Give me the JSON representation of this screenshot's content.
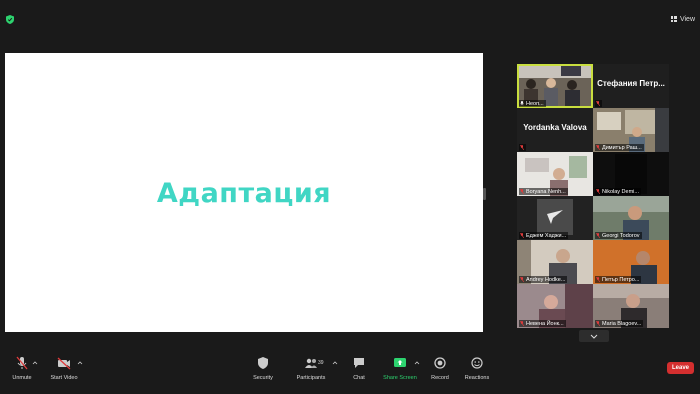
{
  "header": {
    "view_label": "View"
  },
  "share": {
    "slide_title": "Адаптация"
  },
  "participants": [
    {
      "name": "Неоп...",
      "video": true,
      "speaking": true
    },
    {
      "name": "Стефания Петр...",
      "video": false,
      "speaking": false
    },
    {
      "name": "Yordanka Valova",
      "video": false,
      "speaking": false
    },
    {
      "name": "Димитър Раш...",
      "video": true,
      "speaking": false
    },
    {
      "name": "Boryana Nenh...",
      "video": true,
      "speaking": false
    },
    {
      "name": "Nikolay Demi...",
      "video": true,
      "speaking": false
    },
    {
      "name": "Еджем Хаджи...",
      "video": true,
      "speaking": false
    },
    {
      "name": "Georgi Todorov",
      "video": true,
      "speaking": false
    },
    {
      "name": "Andrey Hodke...",
      "video": true,
      "speaking": false
    },
    {
      "name": "Петър Петро...",
      "video": true,
      "speaking": false
    },
    {
      "name": "Невена Йонк...",
      "video": true,
      "speaking": false
    },
    {
      "name": "Maria Blagoev...",
      "video": true,
      "speaking": false
    }
  ],
  "toolbar": {
    "unmute": "Unmute",
    "start_video": "Start Video",
    "security": "Security",
    "participants": "Participants",
    "participants_count": "39",
    "chat": "Chat",
    "share_screen": "Share Screen",
    "record": "Record",
    "reactions": "Reactions",
    "leave": "Leave"
  },
  "colors": {
    "accent_teal": "#40d6c4",
    "speaking_border": "#c9de3f",
    "share_green": "#2dd36f",
    "leave_red": "#d42f2f",
    "muted_red": "#e03c3c"
  }
}
